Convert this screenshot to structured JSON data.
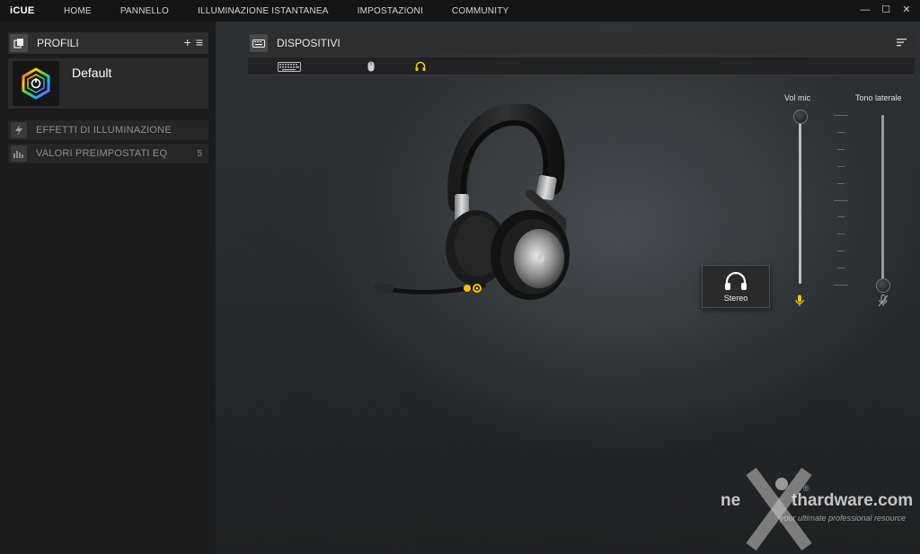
{
  "app": {
    "logo": "iCUE",
    "nav": [
      "HOME",
      "PANNELLO",
      "ILLUMINAZIONE ISTANTANEA",
      "IMPOSTAZIONI",
      "COMMUNITY"
    ],
    "window_controls": {
      "minimize": "—",
      "maximize": "☐",
      "close": "✕"
    }
  },
  "sidebar": {
    "profiles_title": "PROFILI",
    "add_symbol": "+",
    "menu_symbol": "≡",
    "active_profile": "Default",
    "items": [
      {
        "label": "EFFETTI DI ILLUMINAZIONE",
        "icon": "lightning-icon",
        "count": ""
      },
      {
        "label": "VALORI PREIMPOSTATI EQ",
        "icon": "equalizer-icon",
        "count": "5"
      }
    ]
  },
  "devices": {
    "title": "DISPOSITIVI",
    "tabs": [
      {
        "name": "keyboard",
        "icon": "keyboard-icon",
        "active": false
      },
      {
        "name": "mouse",
        "icon": "mouse-icon",
        "active": false
      },
      {
        "name": "headset",
        "icon": "headset-icon",
        "active": true
      }
    ]
  },
  "headset_panel": {
    "mode_label": "Stereo",
    "vol_mic_label": "Vol mic",
    "sidetone_label": "Tono laterale",
    "vol_mic_level": 1.0,
    "sidetone_level": 0.0
  },
  "watermark": {
    "brand_left": "ne",
    "brand_right": "thardware.com",
    "tagline": "your ultimate professional resource",
    "registered": "®"
  },
  "colors": {
    "accent_yellow": "#f5c400",
    "panel_header": "#2e2e2e",
    "background": "#1a1a1a"
  }
}
